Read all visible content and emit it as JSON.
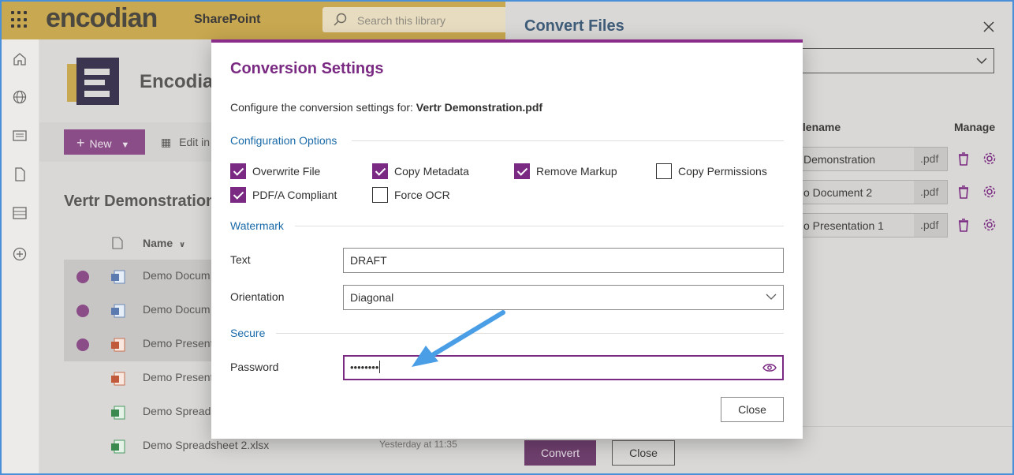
{
  "suite": {
    "brand": "encodian",
    "app": "SharePoint",
    "search_placeholder": "Search this library"
  },
  "site": {
    "title": "Encodian",
    "new_label": "New",
    "edit_grid_label": "Edit in",
    "library_title": "Vertr Demonstration",
    "name_column": "Name"
  },
  "files": [
    {
      "name": "Demo Docum",
      "selected": true,
      "type": "word"
    },
    {
      "name": "Demo Docum",
      "selected": true,
      "type": "word"
    },
    {
      "name": "Demo Present",
      "selected": true,
      "type": "powerpoint"
    },
    {
      "name": "Demo Present",
      "selected": false,
      "type": "powerpoint"
    },
    {
      "name": "Demo Spreads",
      "selected": false,
      "type": "excel"
    },
    {
      "name": "Demo Spreadsheet 2.xlsx",
      "selected": false,
      "type": "excel",
      "date": "Yesterday at 11:35"
    }
  ],
  "panel": {
    "title": "Convert Files",
    "filename_column": "ilename",
    "manage_column": "Manage",
    "rows": [
      {
        "name": "Demonstration",
        "ext": ".pdf"
      },
      {
        "name": "o Document 2",
        "ext": ".pdf"
      },
      {
        "name": "o Presentation 1",
        "ext": ".pdf"
      }
    ],
    "convert_label": "Convert",
    "close_label": "Close"
  },
  "modal": {
    "title": "Conversion Settings",
    "intro_prefix": "Configure the conversion settings for:",
    "intro_file": "Vertr Demonstration.pdf",
    "sections": {
      "config": "Configuration Options",
      "watermark": "Watermark",
      "secure": "Secure"
    },
    "options": {
      "overwrite_file": {
        "label": "Overwrite File",
        "checked": true
      },
      "copy_metadata": {
        "label": "Copy Metadata",
        "checked": true
      },
      "remove_markup": {
        "label": "Remove Markup",
        "checked": true
      },
      "copy_permissions": {
        "label": "Copy Permissions",
        "checked": false
      },
      "pdfa_compliant": {
        "label": "PDF/A Compliant",
        "checked": true
      },
      "force_ocr": {
        "label": "Force OCR",
        "checked": false
      }
    },
    "watermark": {
      "text_label": "Text",
      "text_value": "DRAFT",
      "orientation_label": "Orientation",
      "orientation_value": "Diagonal"
    },
    "secure": {
      "password_label": "Password",
      "password_value": "••••••••"
    },
    "close_label": "Close"
  },
  "colors": {
    "accent": "#7a2a82",
    "section": "#1a6aa8",
    "annotation_arrow": "#4a9ee6"
  }
}
